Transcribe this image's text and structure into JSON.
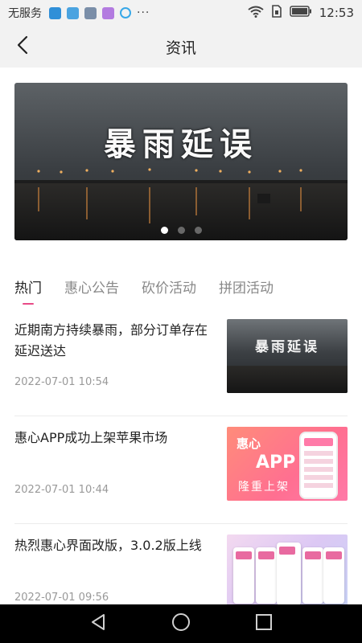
{
  "status_bar": {
    "carrier": "无服务",
    "time": "12:53",
    "more": "···",
    "notification_icons": [
      "qq-icon",
      "chart-app-icon",
      "gallery-icon",
      "message-icon",
      "browser-icon"
    ]
  },
  "header": {
    "title": "资讯",
    "back_icon": "back-arrow-icon"
  },
  "banner": {
    "text": "暴雨延误",
    "slide_count": 3,
    "active_slide": 0
  },
  "tabs": [
    {
      "label": "热门",
      "active": true
    },
    {
      "label": "惠心公告",
      "active": false
    },
    {
      "label": "砍价活动",
      "active": false
    },
    {
      "label": "拼团活动",
      "active": false
    }
  ],
  "news": [
    {
      "title": "近期南方持续暴雨，部分订单存在延迟送达",
      "date": "2022-07-01 10:54",
      "thumb_text": "暴雨延误"
    },
    {
      "title": "惠心APP成功上架苹果市场",
      "date": "2022-07-01 10:44",
      "thumb_lines": [
        "惠心",
        "APP",
        "隆重上架"
      ]
    },
    {
      "title": "热烈惠心界面改版，3.0.2版上线",
      "date": "2022-07-01 09:56"
    }
  ],
  "nav_bar": {
    "icons": [
      "back-triangle-icon",
      "home-circle-icon",
      "recents-square-icon"
    ]
  },
  "colors": {
    "accent": "#e84a86",
    "header_bg": "#f2f2f2",
    "nav_bg": "#000000"
  }
}
